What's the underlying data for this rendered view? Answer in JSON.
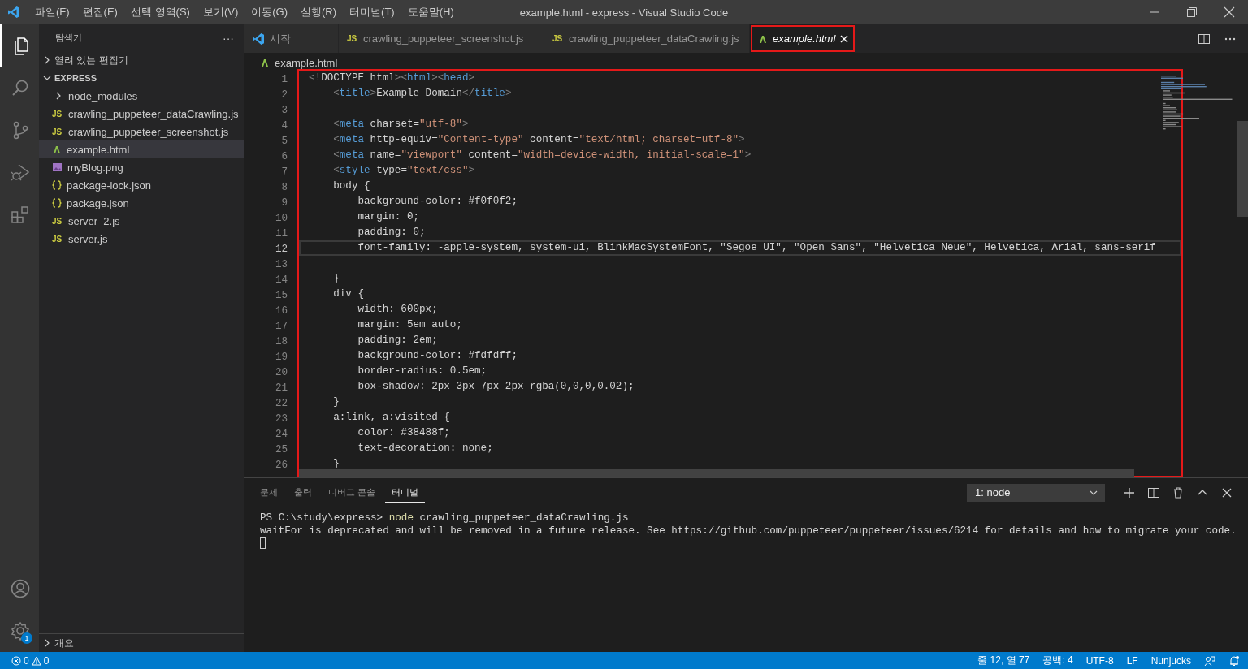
{
  "window": {
    "title": "example.html - express - Visual Studio Code"
  },
  "menu": [
    "파일(F)",
    "편집(E)",
    "선택 영역(S)",
    "보기(V)",
    "이동(G)",
    "실행(R)",
    "터미널(T)",
    "도움말(H)"
  ],
  "activity_bar": [
    {
      "kind": "files",
      "selected": true
    },
    {
      "kind": "search",
      "selected": false
    },
    {
      "kind": "source-control",
      "selected": false
    },
    {
      "kind": "run",
      "selected": false
    },
    {
      "kind": "extensions",
      "selected": false
    },
    {
      "kind": "account",
      "selected": false
    },
    {
      "kind": "settings",
      "selected": false,
      "badge": "1"
    }
  ],
  "sidebar": {
    "title": "탐색기",
    "more": "···",
    "sections": [
      {
        "label": "열려 있는 편집기",
        "bold": false,
        "expanded": false
      },
      {
        "label": "EXPRESS",
        "bold": true,
        "expanded": true,
        "items": [
          {
            "label": "node_modules",
            "kind": "folder",
            "expanded": false,
            "selected": false
          },
          {
            "label": "crawling_puppeteer_dataCrawling.js",
            "kind": "js",
            "icon": "JS",
            "selected": false
          },
          {
            "label": "crawling_puppeteer_screenshot.js",
            "kind": "js",
            "icon": "JS",
            "selected": false
          },
          {
            "label": "example.html",
            "kind": "html",
            "selected": true
          },
          {
            "label": "myBlog.png",
            "kind": "image",
            "selected": false
          },
          {
            "label": "package-lock.json",
            "kind": "json",
            "selected": false
          },
          {
            "label": "package.json",
            "kind": "json",
            "selected": false
          },
          {
            "label": "server_2.js",
            "kind": "js",
            "icon": "JS",
            "selected": false
          },
          {
            "label": "server.js",
            "kind": "js",
            "icon": "JS",
            "selected": false
          }
        ]
      },
      {
        "label": "개요",
        "bold": false,
        "expanded": false
      }
    ]
  },
  "tabs": [
    {
      "label": "시작",
      "kind": "vscode",
      "selected": false,
      "preview": false,
      "highlighted": false
    },
    {
      "label": "crawling_puppeteer_screenshot.js",
      "kind": "js",
      "icon": "JS",
      "selected": false,
      "preview": false,
      "highlighted": false
    },
    {
      "label": "crawling_puppeteer_dataCrawling.js",
      "kind": "js",
      "icon": "JS",
      "selected": false,
      "preview": false,
      "highlighted": false
    },
    {
      "label": "example.html",
      "kind": "html",
      "selected": true,
      "preview": true,
      "highlighted": true
    }
  ],
  "breadcrumb": {
    "label": "example.html",
    "kind": "html"
  },
  "editor": {
    "highlighted": true,
    "lines": [
      {
        "number": "1",
        "tokens": [
          {
            "kind": "punct",
            "t": "<!"
          },
          {
            "kind": "plain",
            "t": "DOCTYPE html"
          },
          {
            "kind": "punct",
            "t": "><"
          },
          {
            "kind": "tag",
            "t": "html"
          },
          {
            "kind": "punct",
            "t": "><"
          },
          {
            "kind": "tag",
            "t": "head"
          },
          {
            "kind": "punct",
            "t": ">"
          }
        ]
      },
      {
        "number": "2",
        "tokens": [
          {
            "kind": "punct",
            "t": "    <"
          },
          {
            "kind": "tag",
            "t": "title"
          },
          {
            "kind": "punct",
            "t": ">"
          },
          {
            "kind": "plain",
            "t": "Example Domain"
          },
          {
            "kind": "punct",
            "t": "</"
          },
          {
            "kind": "tag",
            "t": "title"
          },
          {
            "kind": "punct",
            "t": ">"
          }
        ]
      },
      {
        "number": "3"
      },
      {
        "number": "4",
        "tokens": [
          {
            "kind": "punct",
            "t": "    <"
          },
          {
            "kind": "tag",
            "t": "meta"
          },
          {
            "kind": "plain",
            "t": " charset="
          },
          {
            "kind": "string",
            "t": "\"utf-8\""
          },
          {
            "kind": "punct",
            "t": ">"
          }
        ]
      },
      {
        "number": "5",
        "tokens": [
          {
            "kind": "punct",
            "t": "    <"
          },
          {
            "kind": "tag",
            "t": "meta"
          },
          {
            "kind": "plain",
            "t": " http-equiv="
          },
          {
            "kind": "string",
            "t": "\"Content-type\""
          },
          {
            "kind": "plain",
            "t": " content="
          },
          {
            "kind": "string",
            "t": "\"text/html; charset=utf-8\""
          },
          {
            "kind": "punct",
            "t": ">"
          }
        ]
      },
      {
        "number": "6",
        "tokens": [
          {
            "kind": "punct",
            "t": "    <"
          },
          {
            "kind": "tag",
            "t": "meta"
          },
          {
            "kind": "plain",
            "t": " name="
          },
          {
            "kind": "string",
            "t": "\"viewport\""
          },
          {
            "kind": "plain",
            "t": " content="
          },
          {
            "kind": "string",
            "t": "\"width=device-width, initial-scale=1\""
          },
          {
            "kind": "punct",
            "t": ">"
          }
        ]
      },
      {
        "number": "7",
        "tokens": [
          {
            "kind": "punct",
            "t": "    <"
          },
          {
            "kind": "tag",
            "t": "style"
          },
          {
            "kind": "plain",
            "t": " type="
          },
          {
            "kind": "string",
            "t": "\"text/css\""
          },
          {
            "kind": "punct",
            "t": ">"
          }
        ]
      },
      {
        "number": "8",
        "tokens": [
          {
            "kind": "plain",
            "t": "    body {"
          }
        ]
      },
      {
        "number": "9",
        "tokens": [
          {
            "kind": "plain",
            "t": "        background-color: #f0f0f2;"
          }
        ]
      },
      {
        "number": "10",
        "tokens": [
          {
            "kind": "plain",
            "t": "        margin: 0;"
          }
        ]
      },
      {
        "number": "11",
        "tokens": [
          {
            "kind": "plain",
            "t": "        padding: 0;"
          }
        ]
      },
      {
        "number": "12",
        "current": true,
        "tokens": [
          {
            "kind": "plain",
            "t": "        font-family: -apple-system, system-ui, BlinkMacSystemFont, \"Segoe UI\", \"Open Sans\", \"Helvetica Neue\", Helvetica, Arial, sans-serif"
          }
        ]
      },
      {
        "number": "13"
      },
      {
        "number": "14",
        "tokens": [
          {
            "kind": "plain",
            "t": "    }"
          }
        ]
      },
      {
        "number": "15",
        "tokens": [
          {
            "kind": "plain",
            "t": "    div {"
          }
        ]
      },
      {
        "number": "16",
        "tokens": [
          {
            "kind": "plain",
            "t": "        width: 600px;"
          }
        ]
      },
      {
        "number": "17",
        "tokens": [
          {
            "kind": "plain",
            "t": "        margin: 5em auto;"
          }
        ]
      },
      {
        "number": "18",
        "tokens": [
          {
            "kind": "plain",
            "t": "        padding: 2em;"
          }
        ]
      },
      {
        "number": "19",
        "tokens": [
          {
            "kind": "plain",
            "t": "        background-color: #fdfdff;"
          }
        ]
      },
      {
        "number": "20",
        "tokens": [
          {
            "kind": "plain",
            "t": "        border-radius: 0.5em;"
          }
        ]
      },
      {
        "number": "21",
        "tokens": [
          {
            "kind": "plain",
            "t": "        box-shadow: 2px 3px 7px 2px rgba(0,0,0,0.02);"
          }
        ]
      },
      {
        "number": "22",
        "tokens": [
          {
            "kind": "plain",
            "t": "    }"
          }
        ]
      },
      {
        "number": "23",
        "tokens": [
          {
            "kind": "plain",
            "t": "    a:link, a:visited {"
          }
        ]
      },
      {
        "number": "24",
        "tokens": [
          {
            "kind": "plain",
            "t": "        color: #38488f;"
          }
        ]
      },
      {
        "number": "25",
        "tokens": [
          {
            "kind": "plain",
            "t": "        text-decoration: none;"
          }
        ]
      },
      {
        "number": "26",
        "tokens": [
          {
            "kind": "plain",
            "t": "    }"
          }
        ]
      }
    ]
  },
  "panel": {
    "tabs": [
      {
        "label": "문제",
        "selected": false
      },
      {
        "label": "출력",
        "selected": false
      },
      {
        "label": "디버그 콘솔",
        "selected": false
      },
      {
        "label": "터미널",
        "selected": true
      }
    ],
    "terminal_select": {
      "value": "1: node"
    },
    "terminal": [
      {
        "tokens": [
          {
            "kind": "plain",
            "t": "PS C:\\study\\express> "
          },
          {
            "kind": "command",
            "t": "node"
          },
          {
            "kind": "plain",
            "t": " crawling_puppeteer_dataCrawling.js"
          }
        ]
      },
      {
        "tokens": [
          {
            "kind": "plain",
            "t": "waitFor is deprecated and will be removed in a future release. See https://github.com/puppeteer/puppeteer/issues/6214 for details and how to migrate your code."
          }
        ]
      }
    ]
  },
  "status_bar": {
    "errors": "0",
    "warnings": "0",
    "right": [
      "줄 12, 열 77",
      "공백: 4",
      "UTF-8",
      "LF",
      "Nunjucks"
    ]
  }
}
